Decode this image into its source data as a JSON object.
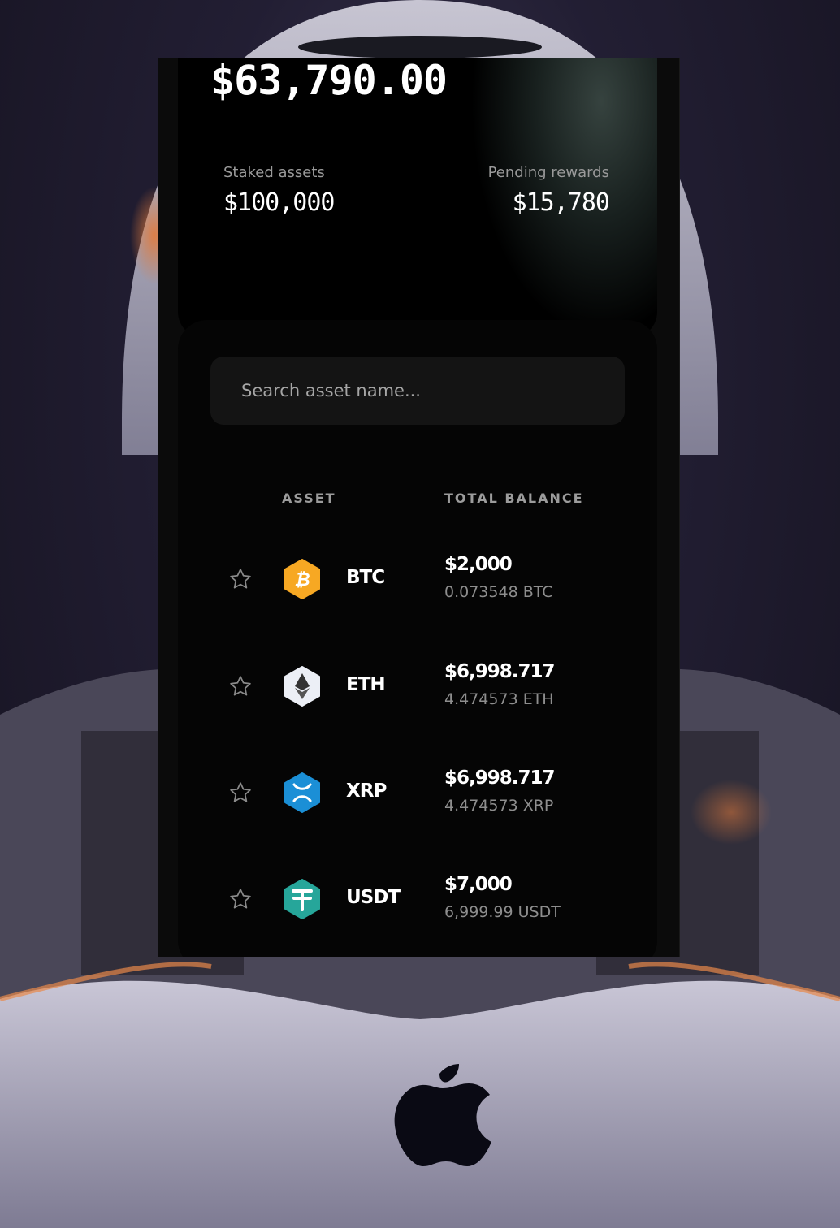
{
  "balance": {
    "total": "$63,790.00",
    "staked_label": "Staked assets",
    "staked_value": "$100,000",
    "pending_label": "Pending rewards",
    "pending_value": "$15,780"
  },
  "search": {
    "placeholder": "Search asset name..."
  },
  "table": {
    "headers": {
      "asset": "ASSET",
      "total_balance": "TOTAL BALANCE"
    },
    "rows": [
      {
        "symbol": "BTC",
        "usd": "$2,000",
        "qty": "0.073548 BTC",
        "icon": "bitcoin-icon",
        "color": "#F7A823"
      },
      {
        "symbol": "ETH",
        "usd": "$6,998.717",
        "qty": "4.474573 ETH",
        "icon": "ethereum-icon",
        "color": "#ECEFF6"
      },
      {
        "symbol": "XRP",
        "usd": "$6,998.717",
        "qty": "4.474573 XRP",
        "icon": "xrp-icon",
        "color": "#1B8FD6"
      },
      {
        "symbol": "USDT",
        "usd": "$7,000",
        "qty": "6,999.99 USDT",
        "icon": "tether-icon",
        "color": "#26A69A"
      }
    ]
  }
}
